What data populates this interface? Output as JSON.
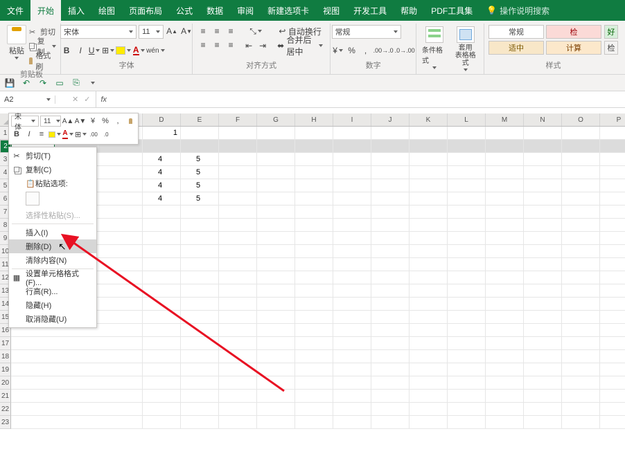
{
  "tabs": {
    "file": "文件",
    "home": "开始",
    "insert": "插入",
    "draw": "绘图",
    "layout": "页面布局",
    "formulas": "公式",
    "data": "数据",
    "review": "审阅",
    "newtab": "新建选项卡",
    "view": "视图",
    "dev": "开发工具",
    "help": "帮助",
    "pdf": "PDF工具集",
    "search": "操作说明搜索"
  },
  "ribbon": {
    "clipboard": {
      "label": "剪贴板",
      "paste": "粘贴",
      "cut": "剪切",
      "copy": "复制",
      "format_painter": "格式刷"
    },
    "font": {
      "label": "字体",
      "name": "宋体",
      "size": "11"
    },
    "alignment": {
      "label": "对齐方式",
      "wrap": "自动换行",
      "merge": "合并后居中"
    },
    "number": {
      "label": "数字",
      "format": "常规"
    },
    "styles": {
      "label": "样式",
      "cond": "条件格式",
      "table": "套用\n表格格式",
      "normal": "常规",
      "check": "检",
      "good": "好",
      "mid": "适中",
      "calc": "计算",
      "linked": "检"
    }
  },
  "namebox": "A2",
  "fx": "fx",
  "mini": {
    "font": "宋体",
    "size": "11"
  },
  "context_menu": {
    "cut": "剪切(T)",
    "copy": "复制(C)",
    "paste_header": "粘贴选项:",
    "paste_special": "选择性粘贴(S)...",
    "insert": "插入(I)",
    "delete": "删除(D)",
    "clear": "清除内容(N)",
    "format_cells": "设置单元格格式(F)...",
    "row_height": "行高(R)...",
    "hide": "隐藏(H)",
    "unhide": "取消隐藏(U)"
  },
  "columns": [
    "D",
    "E",
    "F",
    "G",
    "H",
    "I",
    "J",
    "K",
    "L",
    "M",
    "N",
    "O",
    "P"
  ],
  "row_numbers": [
    "1",
    "2",
    "3",
    "4",
    "5",
    "6",
    "7",
    "8",
    "9",
    "10",
    "11",
    "12",
    "13",
    "14",
    "15",
    "16",
    "17",
    "18",
    "19",
    "20",
    "21",
    "22",
    "23"
  ],
  "cell_d1": "1",
  "cell_d3": "4",
  "cell_e3": "5",
  "cell_d4": "4",
  "cell_e4": "5",
  "cell_d5": "4",
  "cell_e5": "5",
  "cell_d6": "4",
  "cell_e6": "5"
}
